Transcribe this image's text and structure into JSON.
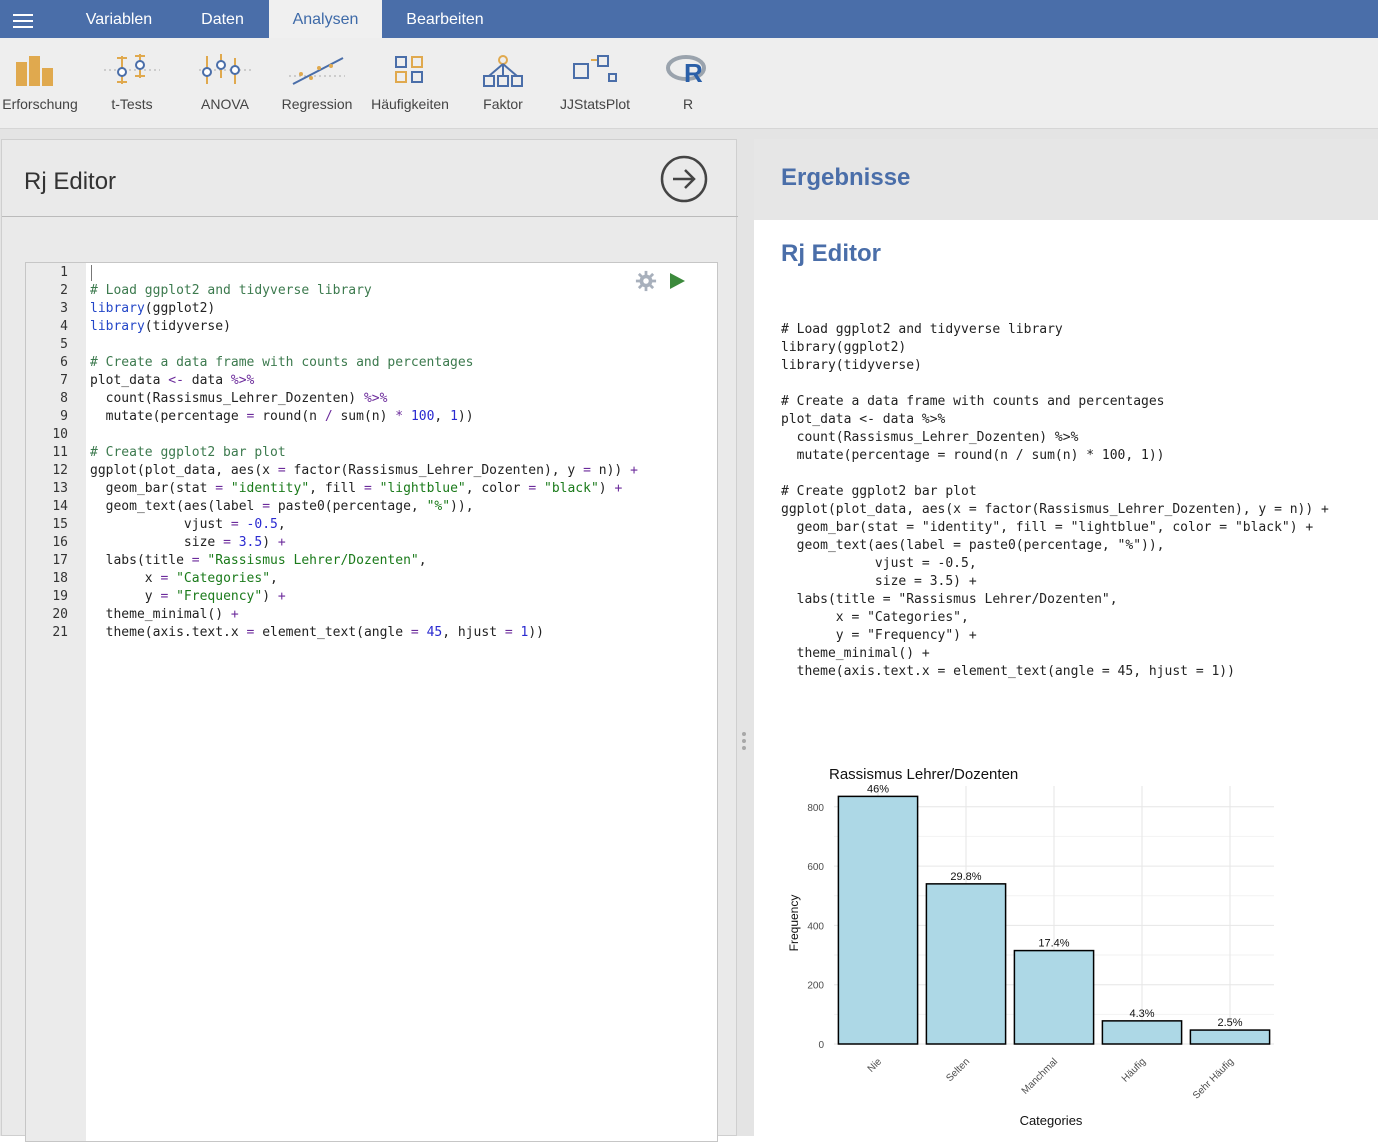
{
  "menu": {
    "icon": "hamburger-menu-icon"
  },
  "tabs": [
    {
      "label": "Variablen",
      "active": false
    },
    {
      "label": "Daten",
      "active": false
    },
    {
      "label": "Analysen",
      "active": true
    },
    {
      "label": "Bearbeiten",
      "active": false
    }
  ],
  "ribbon": [
    {
      "label": "Erforschung",
      "icon": "exploration-bar-chart-icon"
    },
    {
      "label": "t-Tests",
      "icon": "t-tests-icon"
    },
    {
      "label": "ANOVA",
      "icon": "anova-icon"
    },
    {
      "label": "Regression",
      "icon": "regression-icon"
    },
    {
      "label": "Häufigkeiten",
      "icon": "frequencies-icon"
    },
    {
      "label": "Faktor",
      "icon": "factor-icon"
    },
    {
      "label": "JJStatsPlot",
      "icon": "jjstatsplot-icon"
    },
    {
      "label": "R",
      "icon": "r-logo-icon"
    }
  ],
  "editor": {
    "title": "Rj Editor",
    "lines": [
      "",
      "# Load ggplot2 and tidyverse library",
      "library(ggplot2)",
      "library(tidyverse)",
      "",
      "# Create a data frame with counts and percentages",
      "plot_data <- data %>%",
      "  count(Rassismus_Lehrer_Dozenten) %>%",
      "  mutate(percentage = round(n / sum(n) * 100, 1))",
      "",
      "# Create ggplot2 bar plot",
      "ggplot(plot_data, aes(x = factor(Rassismus_Lehrer_Dozenten), y = n)) +",
      "  geom_bar(stat = \"identity\", fill = \"lightblue\", color = \"black\") +",
      "  geom_text(aes(label = paste0(percentage, \"%\")),",
      "            vjust = -0.5,",
      "            size = 3.5) +",
      "  labs(title = \"Rassismus Lehrer/Dozenten\",",
      "       x = \"Categories\",",
      "       y = \"Frequency\") +",
      "  theme_minimal() +",
      "  theme(axis.text.x = element_text(angle = 45, hjust = 1))"
    ]
  },
  "results": {
    "header": "Ergebnisse",
    "subtitle": "Rj Editor",
    "code": "# Load ggplot2 and tidyverse library\nlibrary(ggplot2)\nlibrary(tidyverse)\n\n# Create a data frame with counts and percentages\nplot_data <- data %>%\n  count(Rassismus_Lehrer_Dozenten) %>%\n  mutate(percentage = round(n / sum(n) * 100, 1))\n\n# Create ggplot2 bar plot\nggplot(plot_data, aes(x = factor(Rassismus_Lehrer_Dozenten), y = n)) +\n  geom_bar(stat = \"identity\", fill = \"lightblue\", color = \"black\") +\n  geom_text(aes(label = paste0(percentage, \"%\")),\n            vjust = -0.5,\n            size = 3.5) +\n  labs(title = \"Rassismus Lehrer/Dozenten\",\n       x = \"Categories\",\n       y = \"Frequency\") +\n  theme_minimal() +\n  theme(axis.text.x = element_text(angle = 45, hjust = 1))"
  },
  "colors": {
    "topbar": "#4a6ea9",
    "accent": "#4a6ea9",
    "bar_fill": "#add8e6",
    "play": "#3c8a3c"
  },
  "chart_data": {
    "type": "bar",
    "title": "Rassismus Lehrer/Dozenten",
    "xlabel": "Categories",
    "ylabel": "Frequency",
    "categories": [
      "Nie",
      "Selten",
      "Manchmal",
      "Häufig",
      "Sehr Häufig"
    ],
    "values": [
      835,
      540,
      315,
      78,
      47
    ],
    "labels": [
      "46%",
      "29.8%",
      "17.4%",
      "4.3%",
      "2.5%"
    ],
    "yticks": [
      0,
      200,
      400,
      600,
      800
    ],
    "ylim": [
      0,
      870
    ],
    "grid": true
  }
}
